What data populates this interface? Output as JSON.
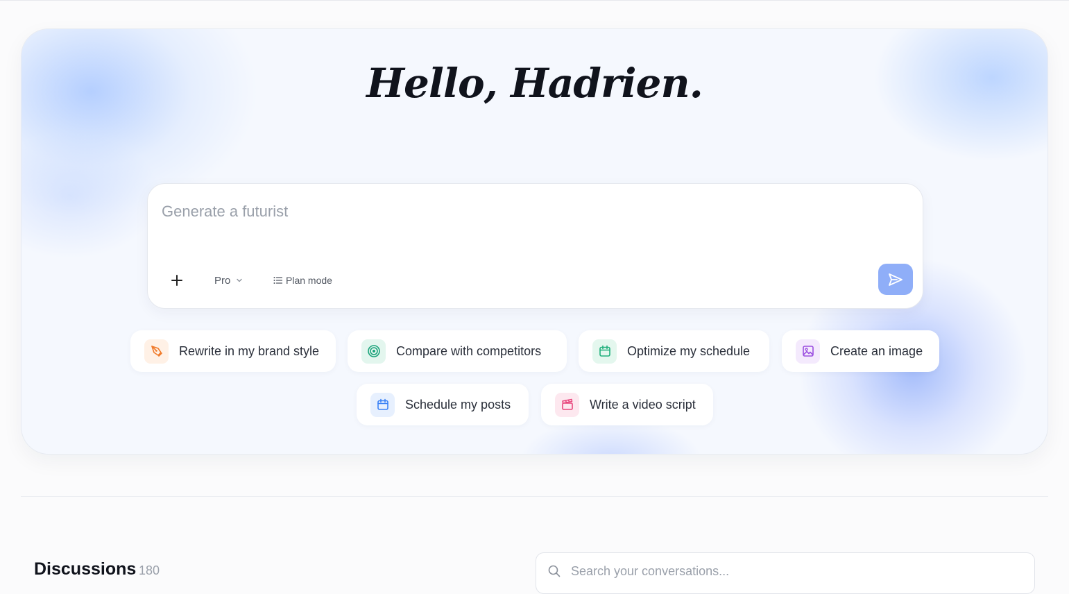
{
  "hero": {
    "greeting": "Hello, Hadrien."
  },
  "composer": {
    "placeholder": "Generate a futurist",
    "model": "Pro",
    "plan_mode_label": "Plan mode",
    "add_icon": "plus-icon",
    "send_icon": "send-icon",
    "send_color": "#8faef8"
  },
  "suggestions": [
    {
      "label": "Rewrite in my brand style",
      "icon": "pen-nib-icon",
      "color": "#f07a2a",
      "bg": "#fff1e6"
    },
    {
      "label": "Compare with competitors",
      "icon": "target-icon",
      "color": "#1aa37a",
      "bg": "#e3f6ee"
    },
    {
      "label": "Optimize my schedule",
      "icon": "calendar-icon",
      "color": "#22b07d",
      "bg": "#e4f7ee"
    },
    {
      "label": "Create an image",
      "icon": "image-icon",
      "color": "#9b4fe0",
      "bg": "#f4eafd"
    },
    {
      "label": "Schedule my posts",
      "icon": "calendar-icon",
      "color": "#3b82f6",
      "bg": "#e7f0fe"
    },
    {
      "label": "Write a video script",
      "icon": "clapperboard-icon",
      "color": "#e8457c",
      "bg": "#fde8ef"
    }
  ],
  "discussions": {
    "title": "Discussions",
    "count": "180",
    "search_placeholder": "Search your conversations..."
  }
}
